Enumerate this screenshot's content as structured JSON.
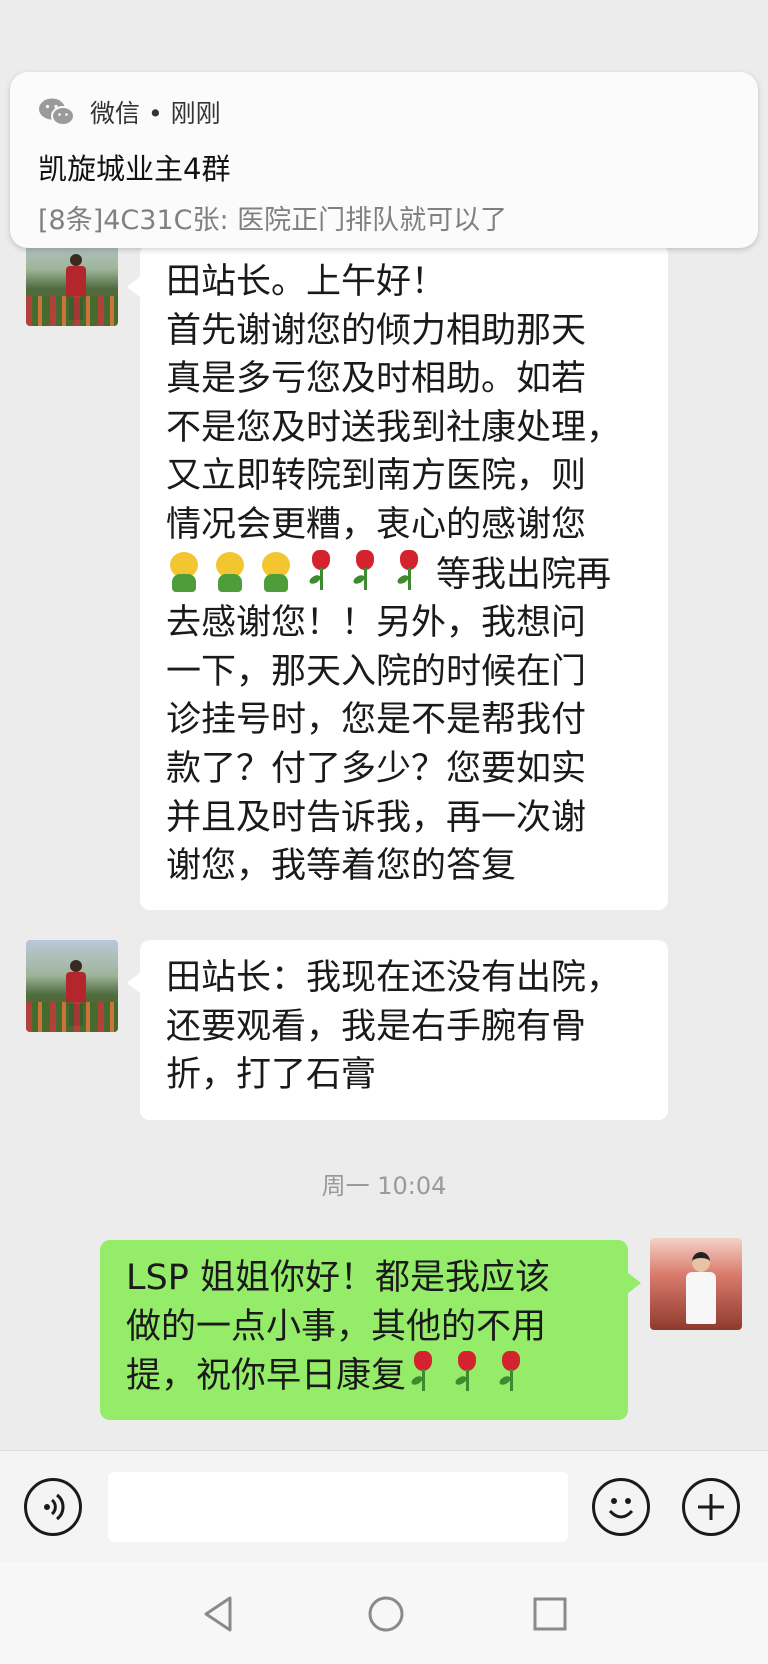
{
  "notification": {
    "app": "微信 • 刚刚",
    "title": "凯旋城业主4群",
    "body": "[8条]4C31C张: 医院正门排队就可以了"
  },
  "messages": [
    {
      "direction": "incoming",
      "lines": [
        "田站长。上午好！",
        "首先谢谢您的倾力相助那天",
        "真是多亏您及时相助。如若",
        "不是您及时送我到社康处理，",
        "又立即转院到南方医院，则",
        "情况会更糟，衷心的感谢您",
        "等我出院再",
        "去感谢您！！另外，我想问",
        "一下，那天入院的时候在门",
        "诊挂号时，您是不是帮我付",
        "款了？付了多少？您要如实",
        "并且及时告诉我，再一次谢",
        "谢您，我等着您的答复"
      ],
      "emoji_line_icons": [
        "face-icon",
        "face-icon",
        "face-icon",
        "rose-icon",
        "rose-icon",
        "rose-icon"
      ]
    },
    {
      "direction": "incoming",
      "lines": [
        "田站长：我现在还没有出院，",
        "还要观看，我是右手腕有骨",
        "折，打了石膏"
      ]
    },
    {
      "direction": "outgoing",
      "lines": [
        "LSP 姐姐你好！都是我应该",
        "做的一点小事，其他的不用",
        "提，祝你早日康复"
      ],
      "trailing_icons": [
        "rose-icon",
        "rose-icon",
        "rose-icon"
      ]
    }
  ],
  "timestamp": "周一 10:04",
  "input": {
    "value": ""
  },
  "colors": {
    "outgoing_bubble": "#95ec69",
    "incoming_bubble": "#ffffff",
    "chat_background": "#ececec"
  }
}
